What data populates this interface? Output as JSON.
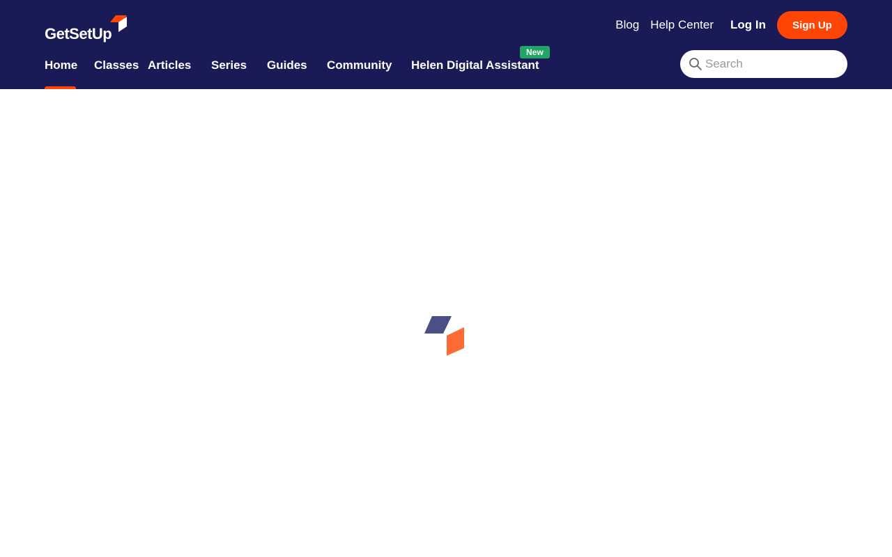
{
  "brand": {
    "name": "GetSetUp",
    "accent_color": "#ff4506",
    "header_color": "#1a1b56"
  },
  "top_links": {
    "blog": "Blog",
    "help_center": "Help Center",
    "login": "Log In",
    "signup": "Sign Up"
  },
  "nav": {
    "home": "Home",
    "classes": "Classes",
    "articles": "Articles",
    "series": "Series",
    "guides": "Guides",
    "community": "Community",
    "helen": "Helen Digital Assistant",
    "new_badge": "New",
    "active": "Home"
  },
  "search": {
    "placeholder": "Search",
    "icon": "search-icon"
  },
  "loader": {
    "icon": "loading-logo-icon"
  }
}
